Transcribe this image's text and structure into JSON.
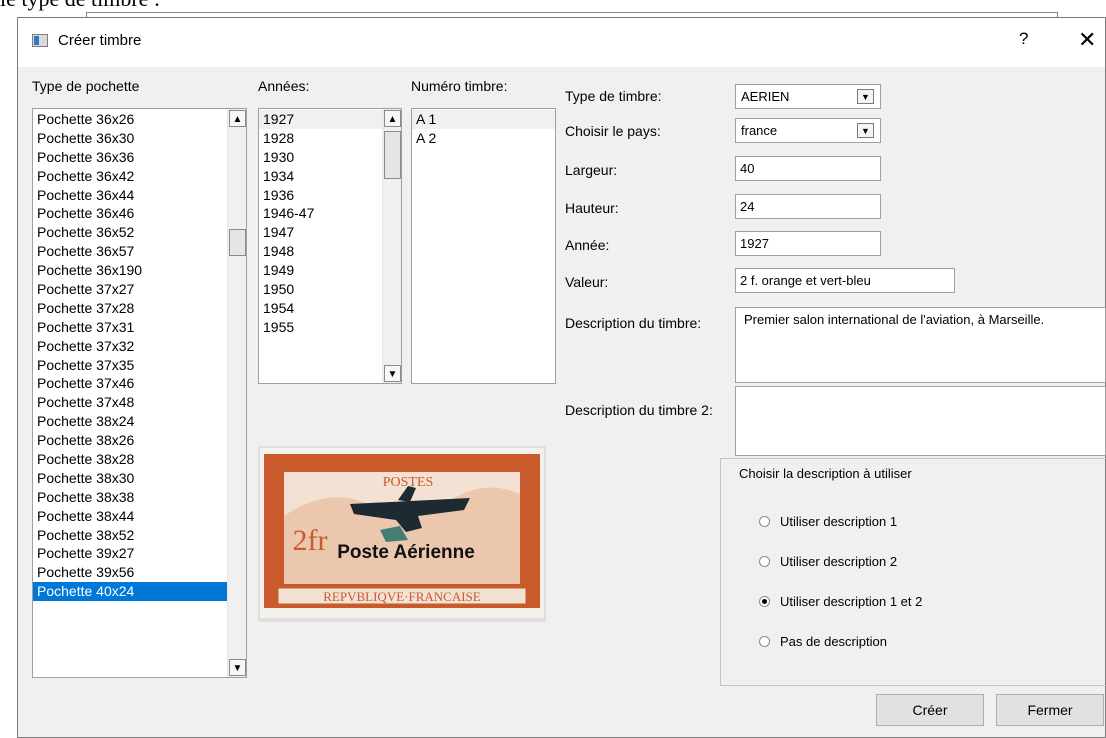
{
  "doc_text": "le type de timbre :",
  "window": {
    "title": "Créer timbre",
    "help_label": "?",
    "close_label": "✕"
  },
  "labels": {
    "type_pochette": "Type de pochette",
    "annees": "Années:",
    "numero_timbre": "Numéro timbre:"
  },
  "pochettes": [
    "Pochette 36x26",
    "Pochette 36x30",
    "Pochette 36x36",
    "Pochette 36x42",
    "Pochette 36x44",
    "Pochette 36x46",
    "Pochette 36x52",
    "Pochette 36x57",
    "Pochette 36x190",
    "Pochette 37x27",
    "Pochette 37x28",
    "Pochette 37x31",
    "Pochette 37x32",
    "Pochette 37x35",
    "Pochette 37x46",
    "Pochette 37x48",
    "Pochette 38x24",
    "Pochette 38x26",
    "Pochette 38x28",
    "Pochette 38x30",
    "Pochette 38x38",
    "Pochette 38x44",
    "Pochette 38x52",
    "Pochette 39x27",
    "Pochette 39x56",
    "Pochette 40x24"
  ],
  "pochette_selected": "Pochette 40x24",
  "annees": [
    "1927",
    "1928",
    "1930",
    "1934",
    "1936",
    "1946-47",
    "1947",
    "1948",
    "1949",
    "1950",
    "1954",
    "1955"
  ],
  "numeros": [
    "A 1",
    "A 2"
  ],
  "form": {
    "type_timbre_label": "Type de timbre:",
    "type_timbre_value": "AERIEN",
    "pays_label": "Choisir le pays:",
    "pays_value": "france",
    "largeur_label": "Largeur:",
    "largeur_value": "40",
    "hauteur_label": "Hauteur:",
    "hauteur_value": "24",
    "annee_label": "Année:",
    "annee_value": "1927",
    "valeur_label": "Valeur:",
    "valeur_value": "2 f. orange et vert-bleu",
    "desc1_label": "Description du timbre:",
    "desc1_value": "Premier salon international de l'aviation, à Marseille.",
    "desc2_label": "Description du timbre 2:",
    "desc2_value": ""
  },
  "group": {
    "title": "Choisir la description à utiliser",
    "options": [
      {
        "label": "Utiliser description 1",
        "checked": false
      },
      {
        "label": "Utiliser description 2",
        "checked": false
      },
      {
        "label": "Utiliser description 1 et 2",
        "checked": true
      },
      {
        "label": "Pas de description",
        "checked": false
      }
    ]
  },
  "stamp": {
    "top_text": "POSTES",
    "value_text": "2fr",
    "overprint": "Poste Aérienne",
    "bottom_text": "REPVBLIQVE·FRANCAISE"
  },
  "buttons": {
    "creer": "Créer",
    "fermer": "Fermer"
  },
  "colors": {
    "selection": "#0078d7",
    "stamp_orange": "#c85a2c"
  }
}
